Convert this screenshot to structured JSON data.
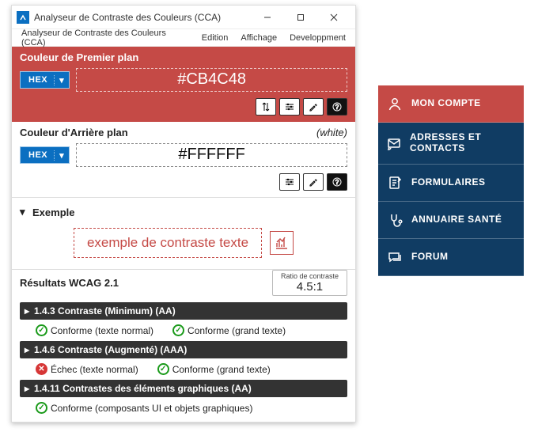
{
  "window": {
    "title": "Analyseur de Contraste des Couleurs (CCA)",
    "menu": [
      "Analyseur de Contraste des Couleurs (CCA)",
      "Edition",
      "Affichage",
      "Developpment"
    ]
  },
  "fg": {
    "label": "Couleur de Premier plan",
    "format": "HEX",
    "value": "#CB4C48"
  },
  "bg": {
    "label": "Couleur d'Arrière plan",
    "format": "HEX",
    "value": "#FFFFFF",
    "name": "(white)"
  },
  "example": {
    "header": "Exemple",
    "text": "exemple de contraste texte"
  },
  "results": {
    "title": "Résultats WCAG 2.1",
    "ratio_label": "Ratio de contraste",
    "ratio": "4.5:1",
    "criteria": [
      {
        "title": "1.4.3 Contraste (Minimum) (AA)",
        "checks": [
          {
            "status": "pass",
            "text": "Conforme (texte normal)"
          },
          {
            "status": "pass",
            "text": "Conforme (grand texte)"
          }
        ]
      },
      {
        "title": "1.4.6 Contraste (Augmenté) (AAA)",
        "checks": [
          {
            "status": "fail",
            "text": "Échec (texte normal)"
          },
          {
            "status": "pass",
            "text": "Conforme (grand texte)"
          }
        ]
      },
      {
        "title": "1.4.11 Contrastes des éléments graphiques (AA)",
        "checks": [
          {
            "status": "pass",
            "text": "Conforme (composants UI et objets graphiques)"
          }
        ]
      }
    ]
  },
  "sidebar": {
    "items": [
      {
        "icon": "user",
        "label": "MON COMPTE"
      },
      {
        "icon": "mail",
        "label": "ADRESSES ET CONTACTS"
      },
      {
        "icon": "form",
        "label": "FORMULAIRES"
      },
      {
        "icon": "health",
        "label": "ANNUAIRE SANTÉ"
      },
      {
        "icon": "chat",
        "label": "FORUM"
      }
    ]
  }
}
